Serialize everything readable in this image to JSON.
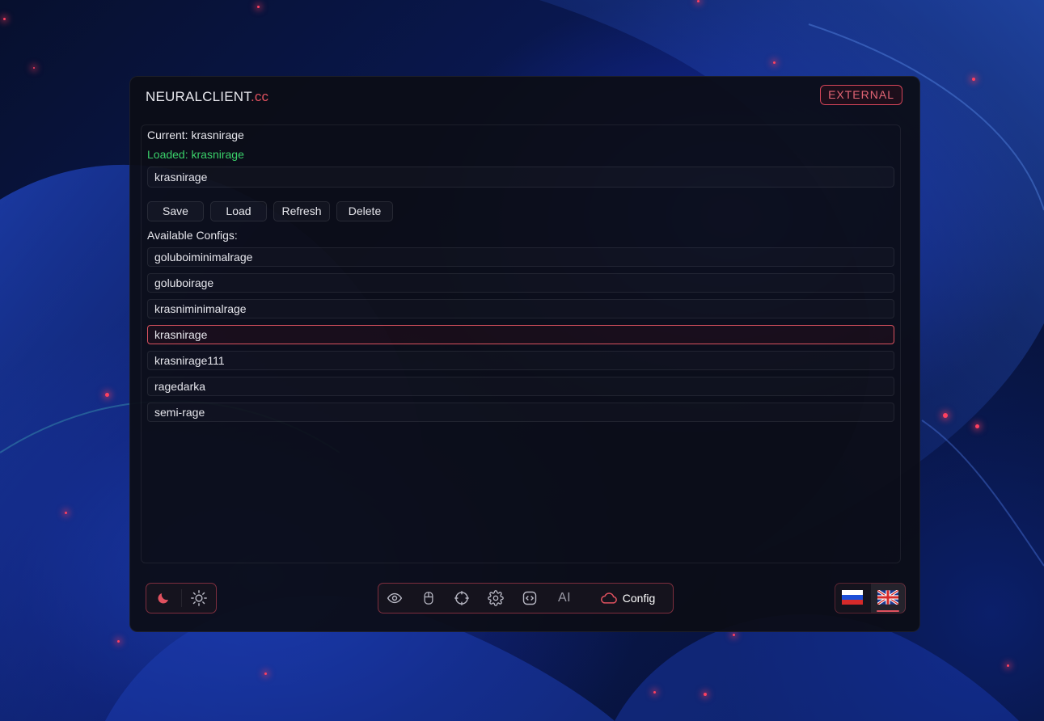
{
  "app": {
    "brand_main": "NEURALCLIENT",
    "brand_suffix": ".cc",
    "mode_badge": "EXTERNAL",
    "accent_color": "#e0515f",
    "loaded_color": "#3ad16a"
  },
  "config_panel": {
    "current_line": "Current: krasnirage",
    "loaded_line": "Loaded: krasnirage",
    "name_input_value": "krasnirage",
    "buttons": {
      "save": "Save",
      "load": "Load",
      "refresh": "Refresh",
      "delete": "Delete"
    },
    "available_label": "Available Configs:",
    "configs": [
      "goluboiminimalrage",
      "goluboirage",
      "krasniminimalrage",
      "krasnirage",
      "krasnirage111",
      "ragedarka",
      "semi-rage"
    ],
    "selected_config": "krasnirage"
  },
  "bottom_bar": {
    "theme_icons": [
      "moon-icon",
      "sun-icon"
    ],
    "nav_icons": [
      "eye-icon",
      "mouse-icon",
      "crosshair-icon",
      "gear-icon",
      "code-icon"
    ],
    "ai_label": "AI",
    "config_label": "Config",
    "config_icon": "cloud-icon",
    "languages": [
      "ru-flag",
      "uk-flag"
    ],
    "selected_language": "uk-flag"
  }
}
